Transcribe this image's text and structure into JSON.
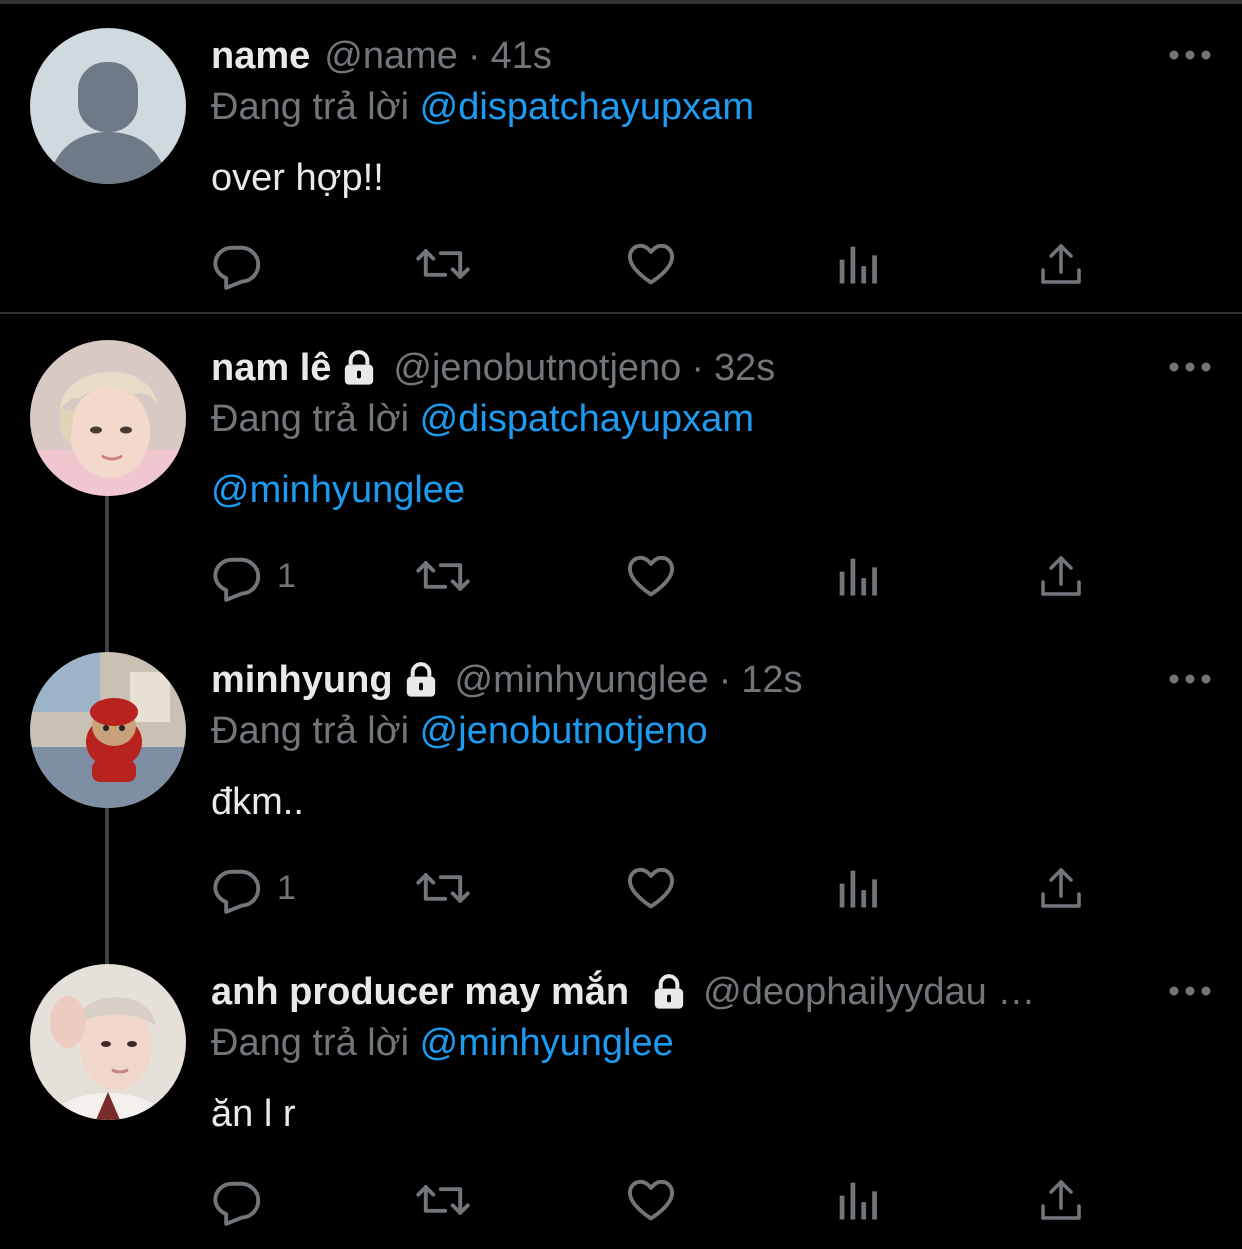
{
  "tweets": [
    {
      "display_name": "name",
      "locked": false,
      "handle": "@name",
      "separator": "·",
      "time": "41s",
      "reply_prefix": "Đang trả lời",
      "reply_to": "@dispatchayupxam",
      "text": "over hợp!!",
      "is_mention_text": false,
      "reply_count": "",
      "avatar": "default-avatar"
    },
    {
      "display_name": "nam lê",
      "locked": true,
      "handle": "@jenobutnotjeno",
      "separator": "·",
      "time": "32s",
      "reply_prefix": "Đang trả lời",
      "reply_to": "@dispatchayupxam",
      "text": "@minhyunglee",
      "is_mention_text": true,
      "reply_count": "1",
      "avatar": "photo-blond-person"
    },
    {
      "display_name": "minhyung",
      "locked": true,
      "handle": "@minhyunglee",
      "separator": "·",
      "time": "12s",
      "reply_prefix": "Đang trả lời",
      "reply_to": "@jenobutnotjeno",
      "text": "đkm..",
      "is_mention_text": false,
      "reply_count": "1",
      "avatar": "photo-plush-bear"
    },
    {
      "display_name": "anh producer may mắn",
      "locked": true,
      "handle": "@deophailyydau …",
      "separator": "",
      "time": "",
      "reply_prefix": "Đang trả lời",
      "reply_to": "@minhyunglee",
      "text": "ăn l r",
      "is_mention_text": false,
      "reply_count": "",
      "avatar": "photo-person-hand"
    }
  ],
  "icons": {
    "reply": "reply-icon",
    "retweet": "retweet-icon",
    "like": "heart-icon",
    "views": "views-icon",
    "share": "share-icon",
    "more": "more-icon",
    "lock": "lock-icon"
  },
  "colors": {
    "background": "#000000",
    "text": "#e7e9ea",
    "muted": "#71767b",
    "link": "#1d9bf0",
    "divider": "#2f3336"
  }
}
